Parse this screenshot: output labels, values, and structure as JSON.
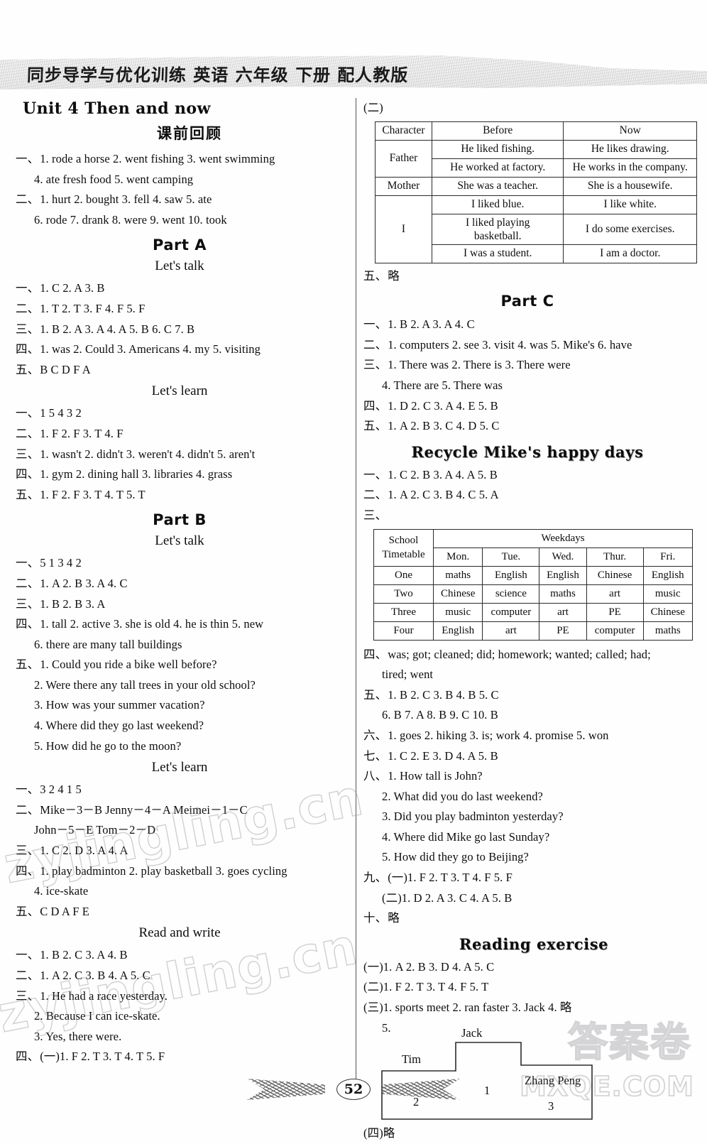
{
  "header": {
    "title": "同步导学与优化训练 英语 六年级 下册 配人教版"
  },
  "page_number": "52",
  "watermarks": {
    "site_1": "zyjingling.cn",
    "site_2": "zyjingling.cn",
    "cn": "答案卷",
    "domain": "MXQE.COM"
  },
  "left_column": {
    "unit_heading": "Unit 4 Then and now",
    "pre_review_heading": "课前回顾",
    "pre_review": [
      {
        "label": "一、",
        "text": "1. rode a horse   2. went fishing   3. went swimming",
        "indent": false
      },
      {
        "label": "",
        "text": "4. ate fresh food   5. went camping",
        "indent": true
      },
      {
        "label": "二、",
        "text": "1. hurt   2. bought   3. fell   4. saw   5. ate",
        "indent": false
      },
      {
        "label": "",
        "text": "6. rode   7. drank   8. were   9. went   10. took",
        "indent": true
      }
    ],
    "part_a_heading": "Part A",
    "part_a_lets_talk_heading": "Let's talk",
    "part_a_lets_talk": [
      {
        "label": "一、",
        "text": "1. C   2. A   3. B",
        "indent": false
      },
      {
        "label": "二、",
        "text": "1. T   2. T   3. F   4. F   5. F",
        "indent": false
      },
      {
        "label": "三、",
        "text": "1. B   2. A   3. A   4. A   5. B   6. C   7. B",
        "indent": false
      },
      {
        "label": "四、",
        "text": "1. was   2. Could   3. Americans   4. my   5. visiting",
        "indent": false
      },
      {
        "label": "五、",
        "text": "B  C  D  F  A",
        "indent": false
      }
    ],
    "part_a_lets_learn_heading": "Let's learn",
    "part_a_lets_learn": [
      {
        "label": "一、",
        "text": "1  5  4  3  2",
        "indent": false
      },
      {
        "label": "二、",
        "text": "1. F   2. F   3. T   4. F",
        "indent": false
      },
      {
        "label": "三、",
        "text": "1. wasn't   2. didn't   3. weren't   4. didn't   5. aren't",
        "indent": false
      },
      {
        "label": "四、",
        "text": "1. gym   2. dining hall   3. libraries   4. grass",
        "indent": false
      },
      {
        "label": "五、",
        "text": "1. F   2. F   3. T   4. T   5. T",
        "indent": false
      }
    ],
    "part_b_heading": "Part B",
    "part_b_lets_talk_heading": "Let's talk",
    "part_b_lets_talk": [
      {
        "label": "一、",
        "text": "5  1  3  4  2",
        "indent": false
      },
      {
        "label": "二、",
        "text": "1. A   2. B   3. A   4. C",
        "indent": false
      },
      {
        "label": "三、",
        "text": "1. B   2. B   3. A",
        "indent": false
      },
      {
        "label": "四、",
        "text": "1. tall   2. active   3. she is old   4. he is thin   5. new",
        "indent": false
      },
      {
        "label": "",
        "text": "6. there are many tall buildings",
        "indent": true
      },
      {
        "label": "五、",
        "text": "1. Could you ride a bike well before?",
        "indent": false
      },
      {
        "label": "",
        "text": "2. Were there any tall trees in your old school?",
        "indent": true
      },
      {
        "label": "",
        "text": "3. How was your summer vacation?",
        "indent": true
      },
      {
        "label": "",
        "text": "4. Where did they go last weekend?",
        "indent": true
      },
      {
        "label": "",
        "text": "5. How did he go to the moon?",
        "indent": true
      }
    ],
    "part_b_lets_learn_heading": "Let's learn",
    "part_b_lets_learn": [
      {
        "label": "一、",
        "text": "3  2  4  1  5",
        "indent": false
      },
      {
        "label": "二、",
        "text": "Mike－3－B   Jenny－4－A   Meimei－1－C",
        "indent": false
      },
      {
        "label": "",
        "text": "John－5－E   Tom－2－D",
        "indent": true
      },
      {
        "label": "三、",
        "text": "1. C   2. D   3. A   4. A",
        "indent": false
      },
      {
        "label": "四、",
        "text": "1. play badminton   2. play basketball   3. goes cycling",
        "indent": false
      },
      {
        "label": "",
        "text": "4. ice-skate",
        "indent": true
      },
      {
        "label": "五、",
        "text": "C  D  A  F  E",
        "indent": false
      }
    ],
    "read_and_write_heading": "Read and write",
    "read_and_write": [
      {
        "label": "一、",
        "text": "1. B   2. C   3. A   4. B",
        "indent": false
      },
      {
        "label": "二、",
        "text": "1. A   2. C   3. B   4. A   5. C",
        "indent": false
      },
      {
        "label": "三、",
        "text": "1. He had a race yesterday.",
        "indent": false
      },
      {
        "label": "",
        "text": "2. Because I can ice-skate.",
        "indent": true
      },
      {
        "label": "",
        "text": "3. Yes, there were.",
        "indent": true
      },
      {
        "label": "四、",
        "text": "(一)1. F   2. T   3. T   4. T   5. F",
        "indent": false
      }
    ]
  },
  "right_column": {
    "section_label_er": "(二)",
    "characters_table": {
      "headers": [
        "Character",
        "Before",
        "Now"
      ],
      "rows": [
        {
          "character": "Father",
          "rowspan": 2,
          "cells": [
            {
              "before": "He liked fishing.",
              "now": "He likes drawing."
            },
            {
              "before": "He worked at factory.",
              "now": "He works in the company."
            }
          ]
        },
        {
          "character": "Mother",
          "rowspan": 1,
          "cells": [
            {
              "before": "She was a teacher.",
              "now": "She is a housewife."
            }
          ]
        },
        {
          "character": "I",
          "rowspan": 3,
          "cells": [
            {
              "before": "I liked blue.",
              "now": "I like white."
            },
            {
              "before": "I liked playing basketball.",
              "now": "I do some exercises."
            },
            {
              "before": "I was a student.",
              "now": "I am a doctor."
            }
          ]
        }
      ]
    },
    "after_table_line": {
      "label": "五、",
      "text": "略"
    },
    "part_c_heading": "Part C",
    "part_c": [
      {
        "label": "一、",
        "text": "1. B   2. A   3. A   4. C",
        "indent": false
      },
      {
        "label": "二、",
        "text": "1. computers   2. see   3. visit   4. was   5. Mike's   6. have",
        "indent": false
      },
      {
        "label": "三、",
        "text": "1. There was   2. There is   3. There were",
        "indent": false
      },
      {
        "label": "",
        "text": "4. There are   5. There was",
        "indent": true
      },
      {
        "label": "四、",
        "text": "1. D   2. C   3. A   4. E   5. B",
        "indent": false
      },
      {
        "label": "五、",
        "text": "1. A   2. B   3. C   4. D   5. C",
        "indent": false
      }
    ],
    "recycle_heading": "Recycle  Mike's happy days",
    "recycle_pre": [
      {
        "label": "一、",
        "text": "1. C   2. B   3. A   4. A   5. B",
        "indent": false
      },
      {
        "label": "二、",
        "text": "1. A   2. C   3. B   4. C   5. A",
        "indent": false
      },
      {
        "label": "三、",
        "text": "",
        "indent": false
      }
    ],
    "timetable": {
      "corner_line1": "School",
      "corner_line2": "Timetable",
      "group_header": "Weekdays",
      "days": [
        "Mon.",
        "Tue.",
        "Wed.",
        "Thur.",
        "Fri."
      ],
      "rows": [
        {
          "period": "One",
          "subjects": [
            "maths",
            "English",
            "English",
            "Chinese",
            "English"
          ]
        },
        {
          "period": "Two",
          "subjects": [
            "Chinese",
            "science",
            "maths",
            "art",
            "music"
          ]
        },
        {
          "period": "Three",
          "subjects": [
            "music",
            "computer",
            "art",
            "PE",
            "Chinese"
          ]
        },
        {
          "period": "Four",
          "subjects": [
            "English",
            "art",
            "PE",
            "computer",
            "maths"
          ]
        }
      ]
    },
    "recycle_post": [
      {
        "label": "四、",
        "text": "was; got; cleaned; did; homework; wanted; called; had;",
        "indent": false
      },
      {
        "label": "",
        "text": "tired; went",
        "indent": true
      },
      {
        "label": "五、",
        "text": "1. B   2. C   3. B   4. B   5. C",
        "indent": false
      },
      {
        "label": "",
        "text": "6. B   7. A   8. B   9. C   10. B",
        "indent": true
      },
      {
        "label": "六、",
        "text": "1. goes   2. hiking   3. is; work   4. promise   5. won",
        "indent": false
      },
      {
        "label": "七、",
        "text": "1. C   2. E   3. D   4. A   5. B",
        "indent": false
      },
      {
        "label": "八、",
        "text": "1. How tall is John?",
        "indent": false
      },
      {
        "label": "",
        "text": "2. What did you do last weekend?",
        "indent": true
      },
      {
        "label": "",
        "text": "3. Did you play badminton yesterday?",
        "indent": true
      },
      {
        "label": "",
        "text": "4. Where did Mike go last Sunday?",
        "indent": true
      },
      {
        "label": "",
        "text": "5. How did they go to Beijing?",
        "indent": true
      },
      {
        "label": "九、",
        "text": "(一)1. F   2. T   3. T   4. F   5. F",
        "indent": false
      },
      {
        "label": "",
        "text": "(二)1. D   2. A   3. C   4. A   5. B",
        "indent": true
      },
      {
        "label": "十、",
        "text": "略",
        "indent": false
      }
    ],
    "reading_heading": "Reading exercise",
    "reading": [
      {
        "label": "",
        "text": "(一)1. A   2. B   3. D   4. A   5. C",
        "indent": false
      },
      {
        "label": "",
        "text": "(二)1. F   2. T   3. T   4. F   5. T",
        "indent": false
      },
      {
        "label": "",
        "text": "(三)1. sports meet   2. ran faster   3. Jack   4. 略",
        "indent": false
      },
      {
        "label": "",
        "text": "5.",
        "indent": true
      }
    ],
    "podium": {
      "first": {
        "name": "Jack",
        "rank": "1"
      },
      "second": {
        "name": "Tim",
        "rank": "2"
      },
      "third": {
        "name": "Zhang Peng",
        "rank": "3"
      }
    },
    "reading_tail": "(四)略"
  }
}
